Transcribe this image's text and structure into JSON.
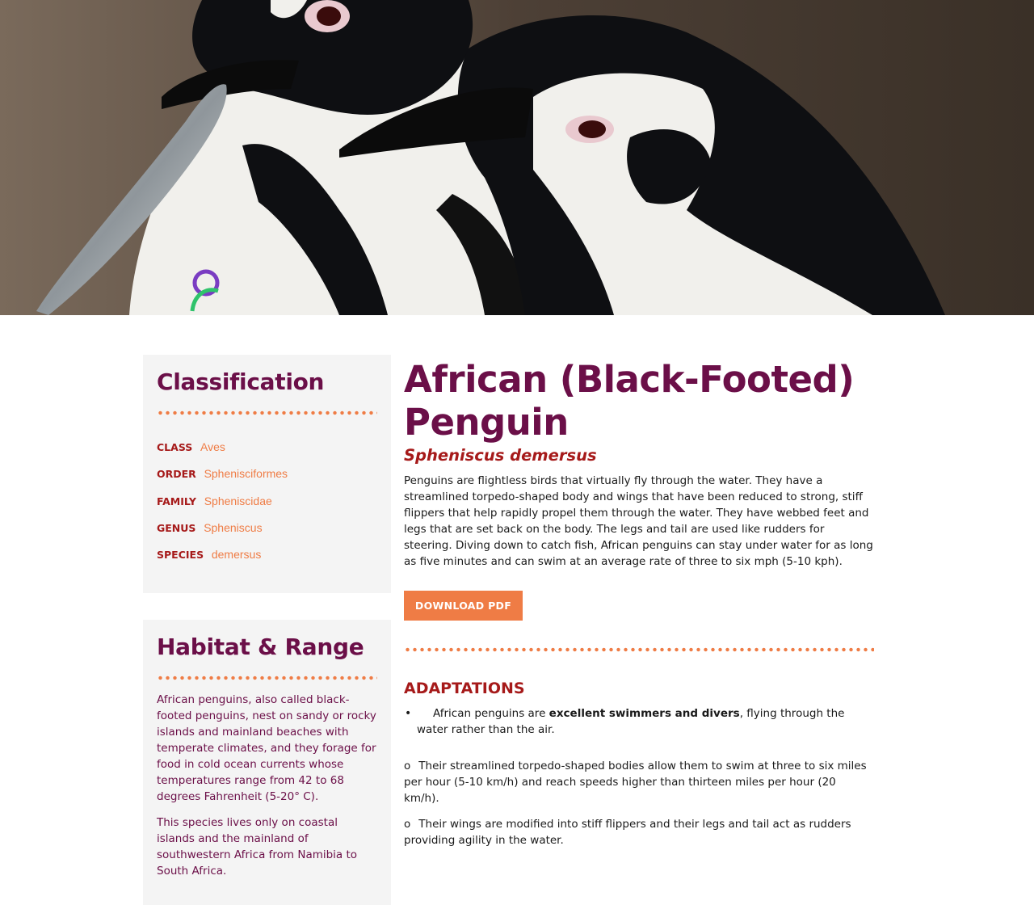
{
  "hero": {
    "image": "african-penguins-feeding-photo",
    "colors": {
      "background": "#5e4f41",
      "black": "#0e0f12",
      "white": "#f1f0ec"
    }
  },
  "classification": {
    "heading": "Classification",
    "items": [
      {
        "key": "CLASS",
        "value": "Aves"
      },
      {
        "key": "ORDER",
        "value": "Sphenisciformes"
      },
      {
        "key": "FAMILY",
        "value": "Spheniscidae"
      },
      {
        "key": "GENUS",
        "value": "Spheniscus"
      },
      {
        "key": "SPECIES",
        "value": "demersus"
      }
    ]
  },
  "habitat": {
    "heading": "Habitat & Range",
    "paragraphs": [
      "African penguins, also called black-footed penguins, nest on sandy or rocky islands and mainland beaches with temperate climates, and they forage for food in cold ocean currents whose temperatures range from 42 to 68 degrees Fahrenheit (5-20° C).",
      "This species lives only on coastal islands and the mainland of southwestern Africa from Namibia to South Africa."
    ]
  },
  "main": {
    "title": "African (Black-Footed) Penguin",
    "scientific_name": "Spheniscus demersus",
    "intro": "Penguins are flightless birds that virtually fly through the water. They have a streamlined torpedo-shaped body and wings that have been reduced to strong, stiff flippers that help rapidly propel them through the water. They have webbed feet and legs that are set back on the body. The legs and tail are used like rudders for steering. Diving down to catch fish, African penguins can stay under water for as long as five minutes and can swim at an average rate of three to six mph (5-10 kph).",
    "download_label": "DOWNLOAD PDF"
  },
  "adaptations": {
    "heading": "ADAPTATIONS",
    "bullet": {
      "marker": "•",
      "before": "African penguins are ",
      "bold": "excellent swimmers and divers",
      "after": ", flying through the water rather than the air."
    },
    "sub_items": [
      {
        "marker": "o",
        "text": "Their streamlined torpedo-shaped bodies allow them to swim at three to six miles per hour (5-10 km/h) and reach speeds higher than thirteen miles per hour (20 km/h)."
      },
      {
        "marker": "o",
        "text": "Their wings are modified into stiff flippers and their legs and tail act as rudders providing agility in the water."
      }
    ]
  },
  "colors": {
    "plum": "#6b0f48",
    "red": "#a61a1a",
    "orange": "#ef7c45",
    "panel": "#f4f4f4"
  }
}
